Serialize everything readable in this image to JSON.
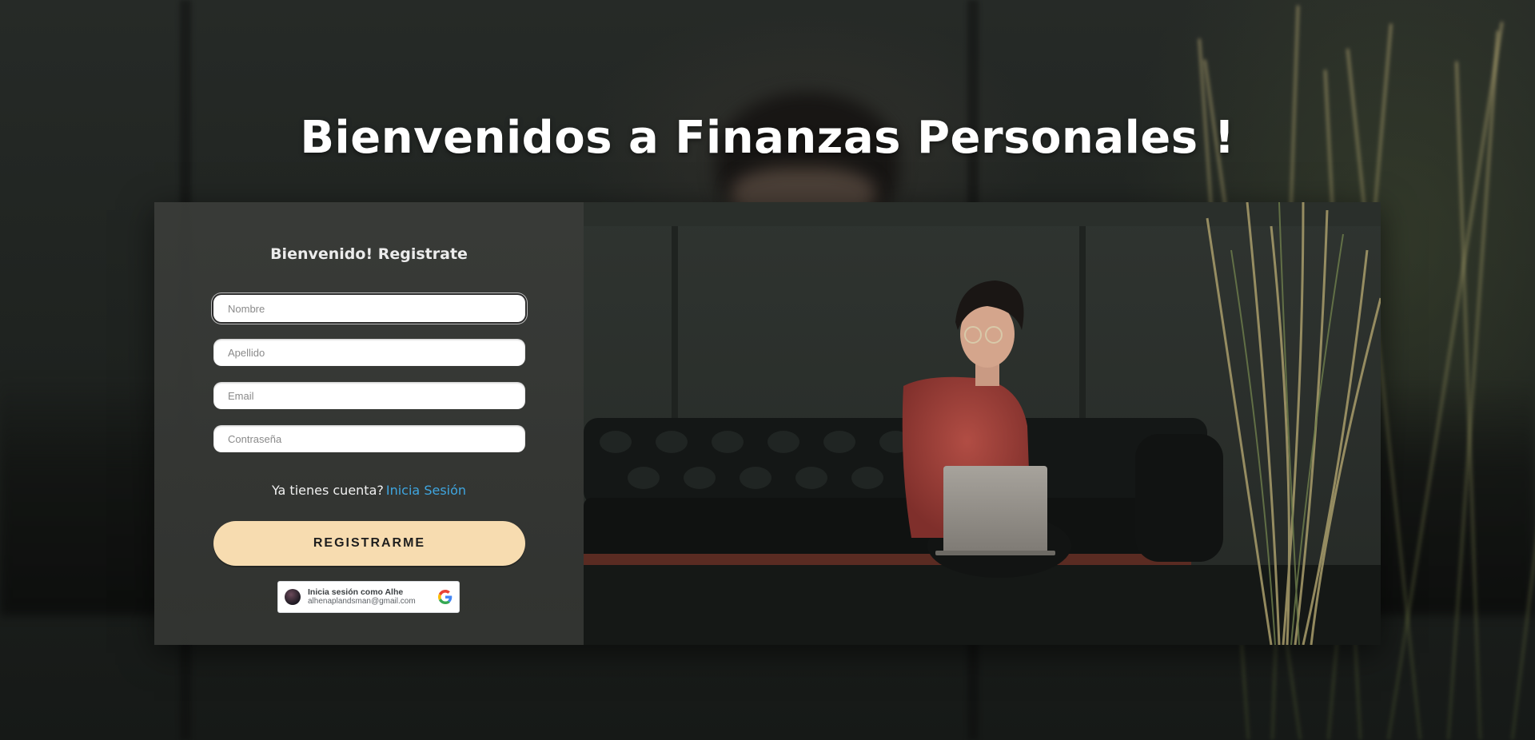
{
  "page": {
    "title": "Bienvenidos a Finanzas Personales !"
  },
  "form": {
    "heading": "Bienvenido! Registrate",
    "fields": {
      "first_name_placeholder": "Nombre",
      "last_name_placeholder": "Apellido",
      "email_placeholder": "Email",
      "password_placeholder": "Contraseña"
    },
    "account_prompt": "Ya tienes cuenta?",
    "login_link": "Inicia Sesión",
    "register_button": "REGISTRARME"
  },
  "google_signin": {
    "label": "Inicia sesión como Alhe",
    "email": "alhenaplandsman@gmail.com",
    "icon": "google-icon",
    "avatar": "user-avatar"
  },
  "colors": {
    "accent_button": "#f7dcb0",
    "link": "#3fa6e0",
    "form_panel": "#3a3c39"
  },
  "photo": {
    "description_icon": "woman-with-laptop-photo"
  }
}
